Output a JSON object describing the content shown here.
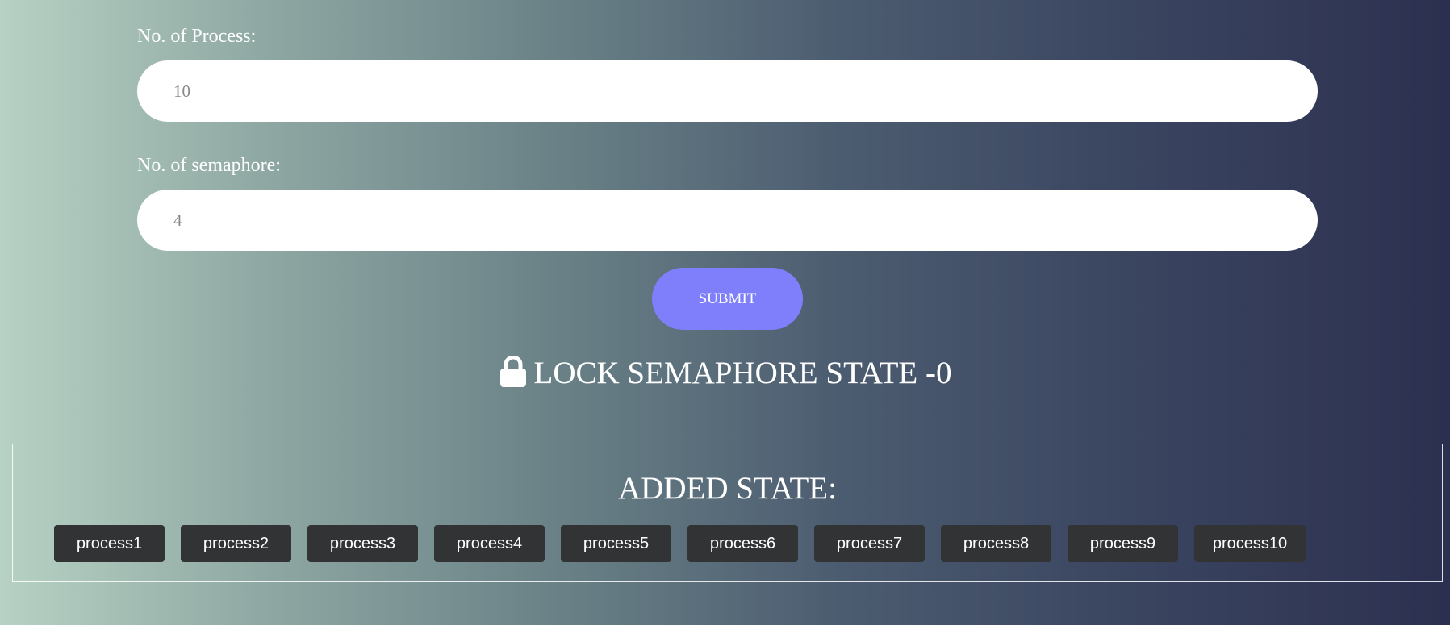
{
  "form": {
    "process_label": "No. of Process:",
    "process_placeholder": "10",
    "semaphore_label": "No. of semaphore:",
    "semaphore_placeholder": "4",
    "submit_label": "SUBMIT"
  },
  "lock_state": {
    "icon": "lock-icon",
    "text": "LOCK SEMAPHORE STATE -0"
  },
  "added_state": {
    "title": "ADDED STATE:",
    "processes": [
      "process1",
      "process2",
      "process3",
      "process4",
      "process5",
      "process6",
      "process7",
      "process8",
      "process9",
      "process10"
    ]
  },
  "colors": {
    "submit_button": "#7f7ffb",
    "process_chip": "#323334",
    "gradient_start": "#b7d2c4",
    "gradient_end": "#2c3050"
  }
}
